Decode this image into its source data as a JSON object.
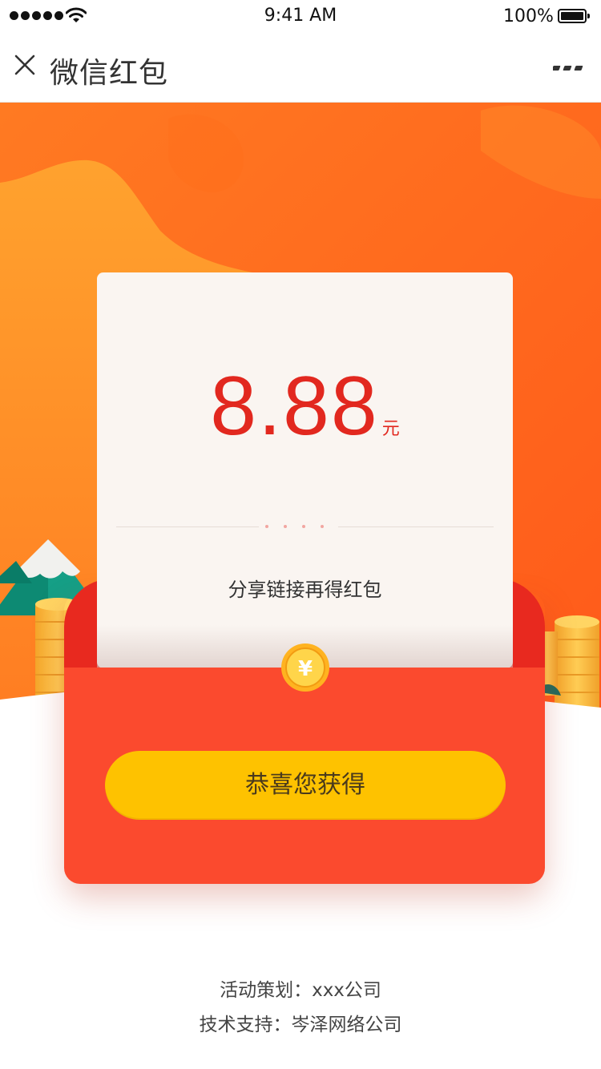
{
  "status_bar": {
    "time": "9:41 AM",
    "battery": "100%"
  },
  "nav": {
    "title": "微信红包",
    "close_icon": "close-icon",
    "more_icon": "more-icon"
  },
  "red_packet": {
    "amount": "8.88",
    "unit": "元",
    "share_text": "分享链接再得红包",
    "coin_symbol": "¥",
    "button_label": "恭喜您获得"
  },
  "footer": {
    "planner": "活动策划：xxx公司",
    "support": "技术支持：岑泽网络公司"
  },
  "colors": {
    "banner_orange": "#ff6a1f",
    "envelope_red": "#fb4a2e",
    "amount_red": "#e2281f",
    "button_yellow": "#fec200"
  }
}
